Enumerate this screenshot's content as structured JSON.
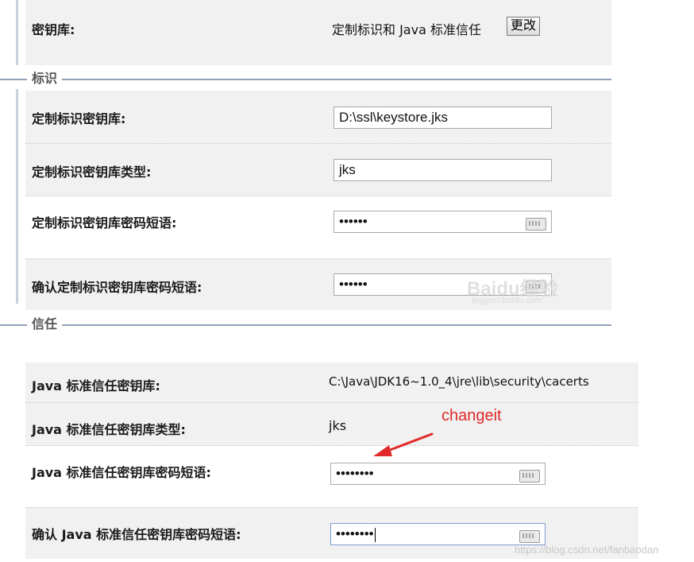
{
  "keystore": {
    "label": "密钥库:",
    "value": "定制标识和 Java 标准信任",
    "change_button": "更改"
  },
  "identity_section": {
    "title": "标识",
    "rows": [
      {
        "label": "定制标识密钥库:",
        "value": "D:\\ssl\\keystore.jks"
      },
      {
        "label": "定制标识密钥库类型:",
        "value": "jks"
      },
      {
        "label": "定制标识密钥库密码短语:",
        "value": "••••••"
      },
      {
        "label": "确认定制标识密钥库密码短语:",
        "value": "••••••"
      }
    ]
  },
  "trust_section": {
    "title": "信任",
    "rows": [
      {
        "label": "Java 标准信任密钥库:",
        "value": "C:\\Java\\JDK16~1.0_4\\jre\\lib\\security\\cacerts"
      },
      {
        "label": "Java 标准信任密钥库类型:",
        "value": "jks"
      },
      {
        "label": "Java 标准信任密钥库密码短语:",
        "value": "••••••••"
      },
      {
        "label": "确认 Java 标准信任密钥库密码短语:",
        "value": "••••••••"
      }
    ]
  },
  "annotation": {
    "text": "changeit",
    "color": "#e02a2a"
  },
  "watermark": {
    "url": "https://blog.csdn.net/fanbaodan",
    "baidu": "Baidu经验",
    "baidu_sub": "jingyan.baidu.com"
  },
  "icons": {
    "keyboard": "keyboard-icon",
    "arrow": "arrow-icon"
  }
}
